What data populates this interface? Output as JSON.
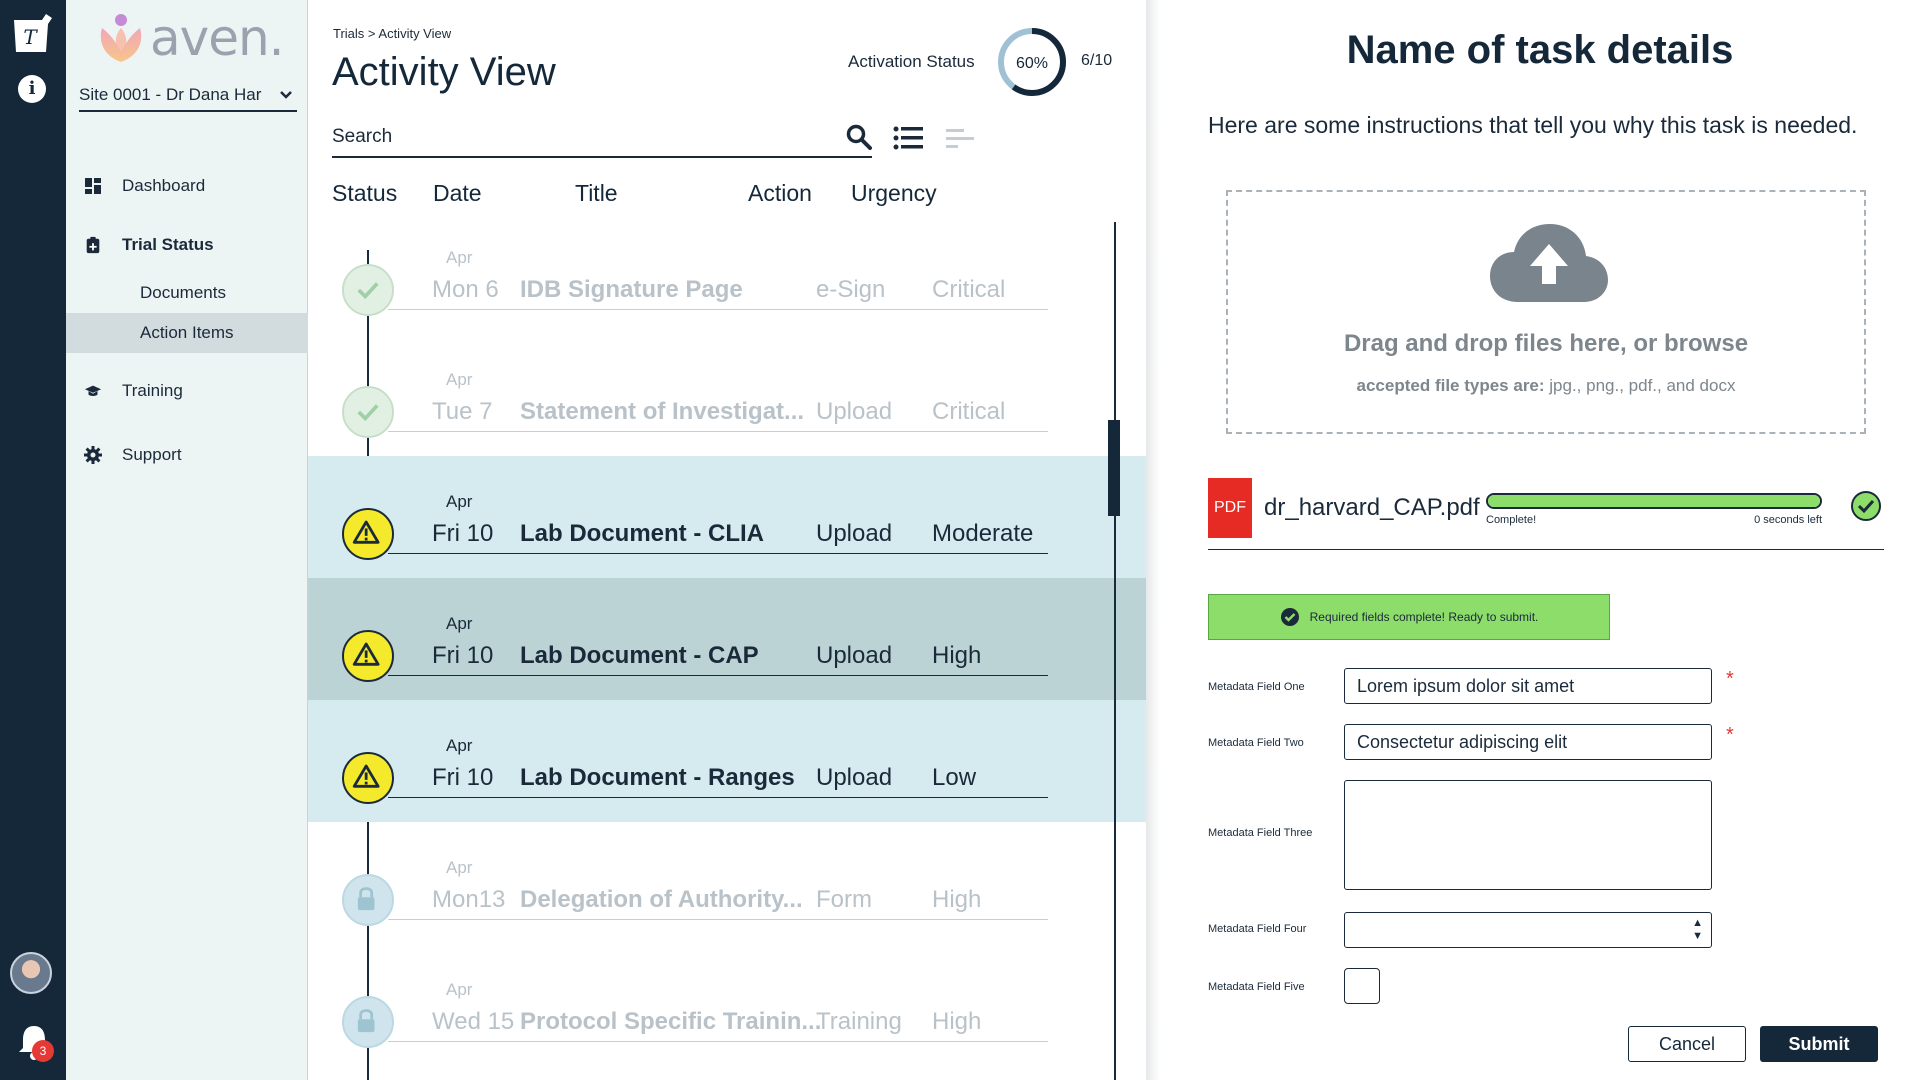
{
  "nav_rail": {
    "notification_count": "3"
  },
  "sidebar": {
    "brand": "aven.",
    "site_selector": "Site 0001 - Dr Dana Har",
    "items": [
      {
        "label": "Dashboard",
        "icon": "dashboard-grid-icon"
      },
      {
        "label": "Trial Status",
        "icon": "clipboard-plus-icon",
        "bold": true
      },
      {
        "label": "Documents",
        "sub": true
      },
      {
        "label": "Action Items",
        "sub": true,
        "active": true
      },
      {
        "label": "Training",
        "icon": "graduation-cap-icon"
      },
      {
        "label": "Support",
        "icon": "gear-icon"
      }
    ]
  },
  "main": {
    "breadcrumb": "Trials > Activity View",
    "title": "Activity View",
    "activation_label": "Activation Status",
    "activation_percent": "60%",
    "activation_value": 0.6,
    "activation_count": "6/10",
    "search_placeholder": "Search",
    "columns": {
      "status": "Status",
      "date": "Date",
      "title": "Title",
      "action": "Action",
      "urgency": "Urgency"
    },
    "rows": [
      {
        "status": "done",
        "month": "Apr",
        "day": "Mon 6",
        "title": "IDB Signature Page",
        "action": "e-Sign",
        "urgency": "Critical",
        "style": "dim"
      },
      {
        "status": "done",
        "month": "Apr",
        "day": "Tue 7",
        "title": "Statement of Investigat...",
        "action": "Upload",
        "urgency": "Critical",
        "style": "dim"
      },
      {
        "status": "warn",
        "month": "Apr",
        "day": "Fri 10",
        "title": "Lab Document - CLIA",
        "action": "Upload",
        "urgency": "Moderate",
        "style": "hl1"
      },
      {
        "status": "warn",
        "month": "Apr",
        "day": "Fri 10",
        "title": "Lab Document - CAP",
        "action": "Upload",
        "urgency": "High",
        "style": "hl2"
      },
      {
        "status": "warn",
        "month": "Apr",
        "day": "Fri 10",
        "title": "Lab Document - Ranges",
        "action": "Upload",
        "urgency": "Low",
        "style": "hl1"
      },
      {
        "status": "lock",
        "month": "Apr",
        "day": "Mon13",
        "title": "Delegation of Authority...",
        "action": "Form",
        "urgency": "High",
        "style": "dim"
      },
      {
        "status": "lock",
        "month": "Apr",
        "day": "Wed 15",
        "title": "Protocol Specific Trainin...",
        "action": "Training",
        "urgency": "High",
        "style": "dim"
      }
    ]
  },
  "panel": {
    "title": "Name of task details",
    "instructions": "Here are some instructions that tell you why this task is needed.",
    "dropzone_text": "Drag and drop files here, or browse",
    "accepted_label": "accepted file types are:",
    "accepted_types": " jpg., png., pdf., and docx",
    "file": {
      "type_badge": "PDF",
      "name": "dr_harvard_CAP.pdf",
      "progress": 1.0,
      "status": "Complete!",
      "time_left": "0 seconds left"
    },
    "ready_message": "Required fields complete! Ready to submit.",
    "fields": [
      {
        "label": "Metadata Field One",
        "value": "Lorem ipsum dolor sit amet",
        "required": "*"
      },
      {
        "label": "Metadata Field Two",
        "value": "Consectetur adipiscing elit",
        "required": "*"
      },
      {
        "label": "Metadata Field Three",
        "value": ""
      },
      {
        "label": "Metadata Field Four",
        "value": ""
      },
      {
        "label": "Metadata Field Five",
        "value": ""
      }
    ],
    "cancel_label": "Cancel",
    "submit_label": "Submit"
  },
  "colors": {
    "navy": "#14283a",
    "highlight_light": "#d5ebef",
    "highlight_dark": "#bcd3d6",
    "warning": "#f5e92c",
    "success": "#8ddd6a",
    "pdf_red": "#e52b23",
    "required": "#e53935"
  }
}
